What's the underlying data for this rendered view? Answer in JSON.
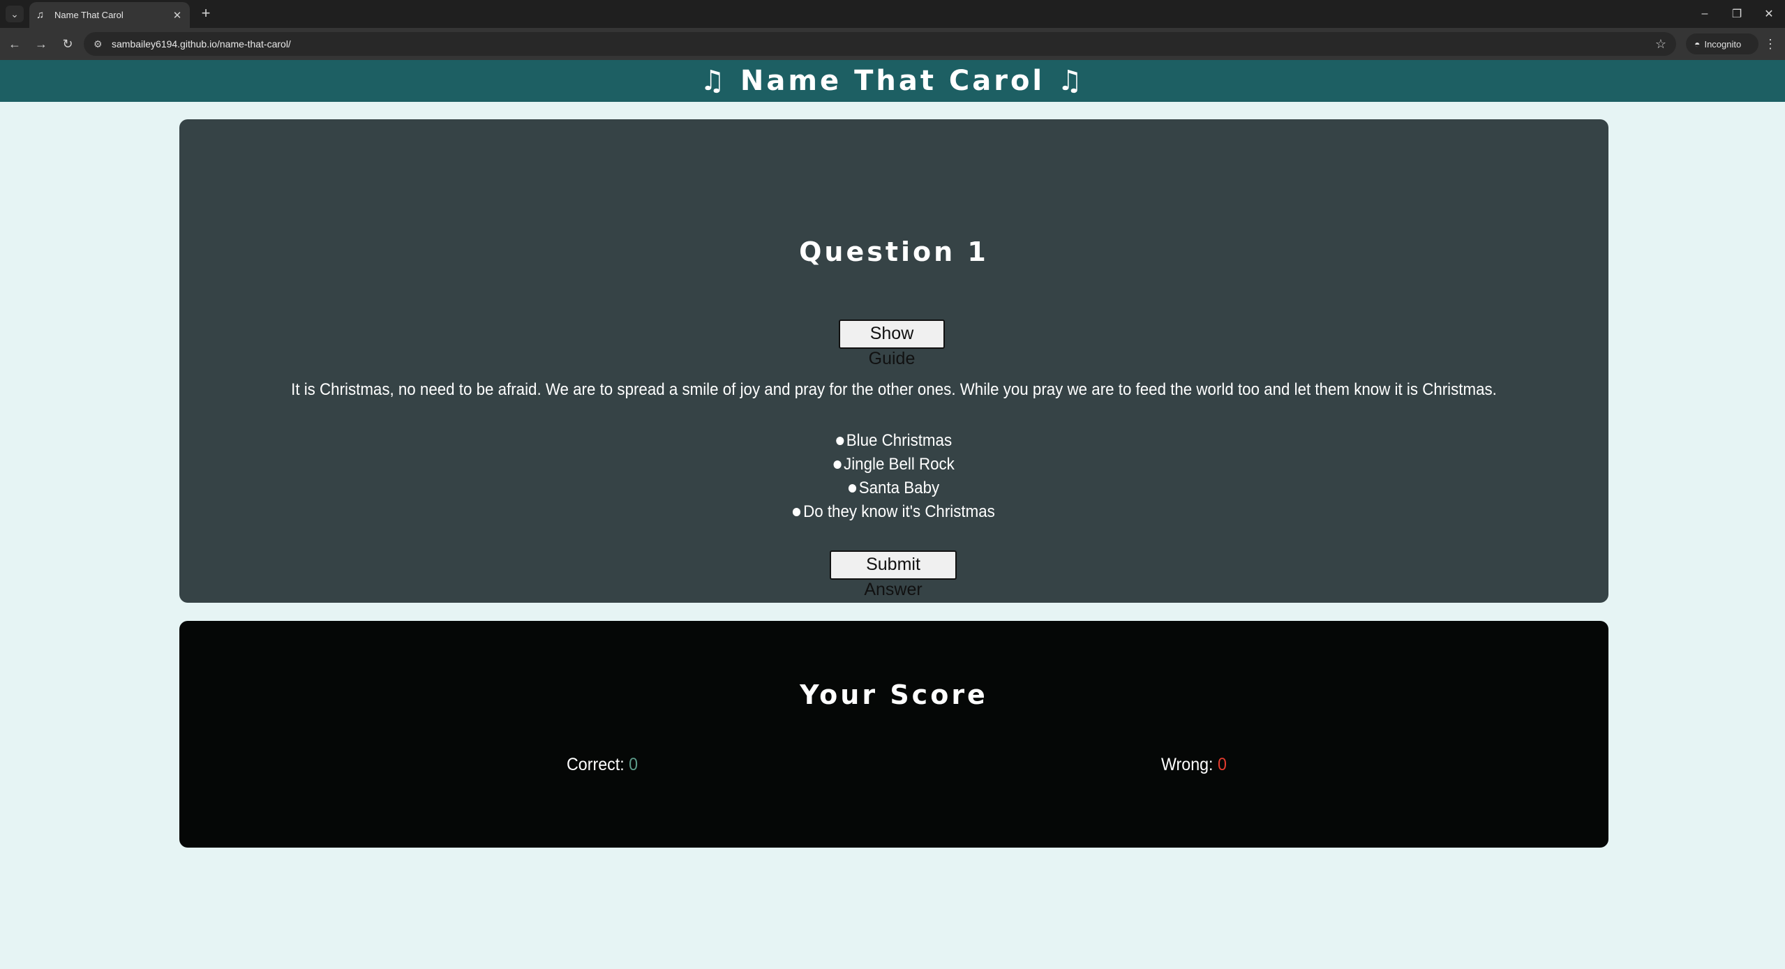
{
  "browser": {
    "tab": {
      "title": "Name That Carol",
      "favicon": "music-note-icon"
    },
    "url": "sambailey6194.github.io/name-that-carol/",
    "incognito_label": "Incognito"
  },
  "header": {
    "title": "Name That Carol",
    "icon": "music-note-icon",
    "color": "#1d5f63"
  },
  "question": {
    "title": "Question 1",
    "guide_button": "Show Guide",
    "lyrics": "It is Christmas, no need to be afraid. We are to spread a smile of joy and pray for the other ones. While you pray we are to feed the world too and let them know it is Christmas.",
    "options": [
      "Blue Christmas",
      "Jingle Bell Rock",
      "Santa Baby",
      "Do they know it's Christmas"
    ],
    "submit_button": "Submit Answer",
    "card_color": "#364346"
  },
  "score": {
    "title": "Your Score",
    "correct_label": "Correct:",
    "correct_value": "0",
    "wrong_label": "Wrong:",
    "wrong_value": "0",
    "correct_color": "#5b9a88",
    "wrong_color": "#e33b2e"
  }
}
